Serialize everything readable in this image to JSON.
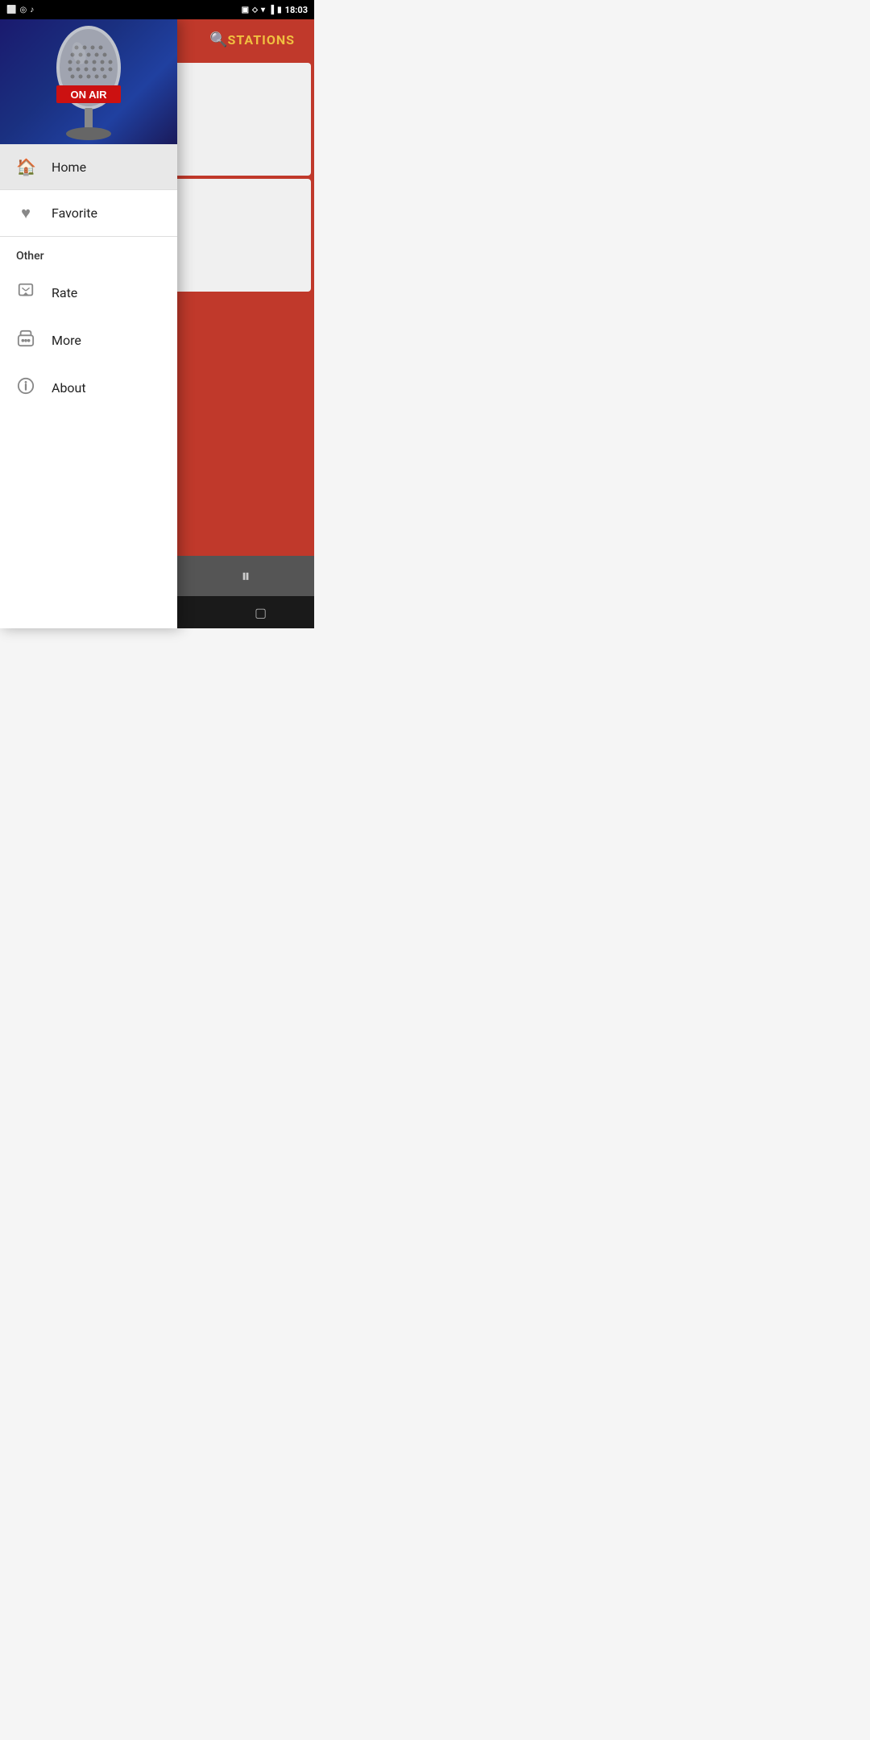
{
  "status_bar": {
    "time": "18:03",
    "icons_left": [
      "sim-icon",
      "camera-icon",
      "music-icon"
    ],
    "icons_right": [
      "cast-icon",
      "wifi-icon",
      "signal-icon",
      "battery-icon"
    ]
  },
  "background": {
    "header_label": "STATIONS",
    "search_label": "🔍"
  },
  "drawer": {
    "hero_alt": "On Air Microphone",
    "nav_items": [
      {
        "id": "home",
        "label": "Home",
        "icon": "home",
        "active": true
      },
      {
        "id": "favorite",
        "label": "Favorite",
        "icon": "heart",
        "active": false
      }
    ],
    "section_other": "Other",
    "other_items": [
      {
        "id": "rate",
        "label": "Rate",
        "icon": "rate"
      },
      {
        "id": "more",
        "label": "More",
        "icon": "more"
      },
      {
        "id": "about",
        "label": "About",
        "icon": "info"
      }
    ]
  },
  "player": {
    "pause_icon": "⏸"
  },
  "nav_bar": {
    "back_icon": "◁",
    "home_icon": "●",
    "recent_icon": "▢"
  }
}
